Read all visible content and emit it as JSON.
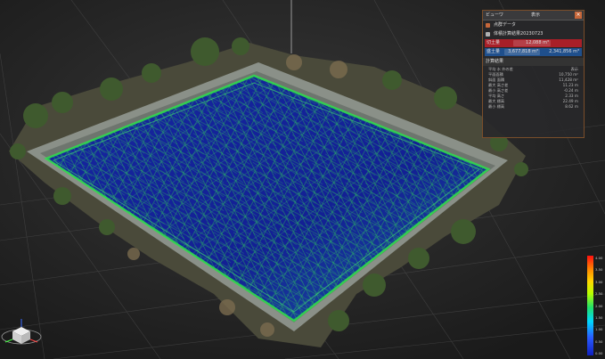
{
  "panel": {
    "col1": "ビューワ",
    "col2": "表示",
    "rows": [
      {
        "label": "点群データ",
        "color": "#c7673a"
      },
      {
        "label": "体積計算結果20230723",
        "color": "#b0b0b0"
      }
    ],
    "cut": {
      "label": "切土量",
      "value": "12,088 m³"
    },
    "fill": {
      "label": "盛土量",
      "value": "3,677,818 m³",
      "total": "2,341,856 m³"
    },
    "section": "計算結果",
    "props": [
      {
        "k": "平均 水 外の差",
        "v": "表示"
      },
      {
        "k": "平面面積",
        "v": "10,750 m²"
      },
      {
        "k": "斜面 面積",
        "v": "11,428 m²"
      },
      {
        "k": "最大 高さ差",
        "v": "11.23 m"
      },
      {
        "k": "最小 高さ差",
        "v": "-0.24 m"
      },
      {
        "k": "平均 高さ",
        "v": "2.33 m"
      },
      {
        "k": "最大 標高",
        "v": "22.49 m"
      },
      {
        "k": "最小 標高",
        "v": "8.62 m"
      }
    ]
  },
  "legend": {
    "ticks": [
      "4.00",
      "3.50",
      "3.00",
      "2.50",
      "2.00",
      "1.50",
      "1.00",
      "0.50",
      "0.00"
    ]
  },
  "colors": {
    "pit_fill": "#1526a8",
    "mesh": "#2fe04a",
    "wall": "#8a9088",
    "cut": "#a81f28",
    "fill_bar": "#1f4f8c",
    "accent": "#c7673a"
  },
  "icons": {
    "view_cube": "view-cube-icon"
  }
}
